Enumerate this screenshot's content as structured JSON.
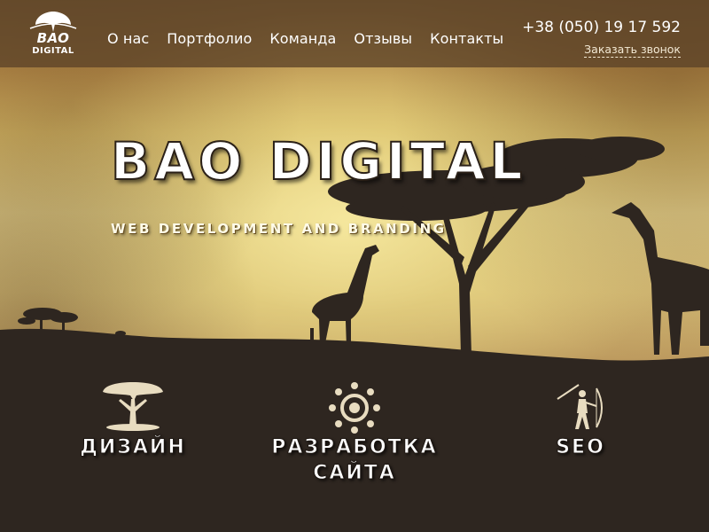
{
  "header": {
    "logo": {
      "line1": "BAO",
      "line2": "DIGITAL",
      "icon": "acacia-tree-icon"
    },
    "nav": [
      {
        "label": "О нас"
      },
      {
        "label": "Портфолио"
      },
      {
        "label": "Команда"
      },
      {
        "label": "Отзывы"
      },
      {
        "label": "Контакты"
      }
    ],
    "phone": "+38 (050) 19 17 592",
    "callback_label": "Заказать звонок"
  },
  "hero": {
    "title": "BAO DIGITAL",
    "subtitle": "WEB DEVELOPMENT AND BRANDING"
  },
  "services": [
    {
      "icon": "acacia-tree-icon",
      "label_lines": [
        "ДИЗАЙН"
      ]
    },
    {
      "icon": "gear-sun-icon",
      "label_lines": [
        "РАЗРАБОТКА",
        "САЙТА"
      ]
    },
    {
      "icon": "hunter-icon",
      "label_lines": [
        "SEO"
      ]
    }
  ],
  "colors": {
    "header_bg": "#5c4228",
    "sky_light": "#e4d08a",
    "silhouette": "#2e2620",
    "text": "#ffffff",
    "icon_fill": "#e8dcc0"
  }
}
